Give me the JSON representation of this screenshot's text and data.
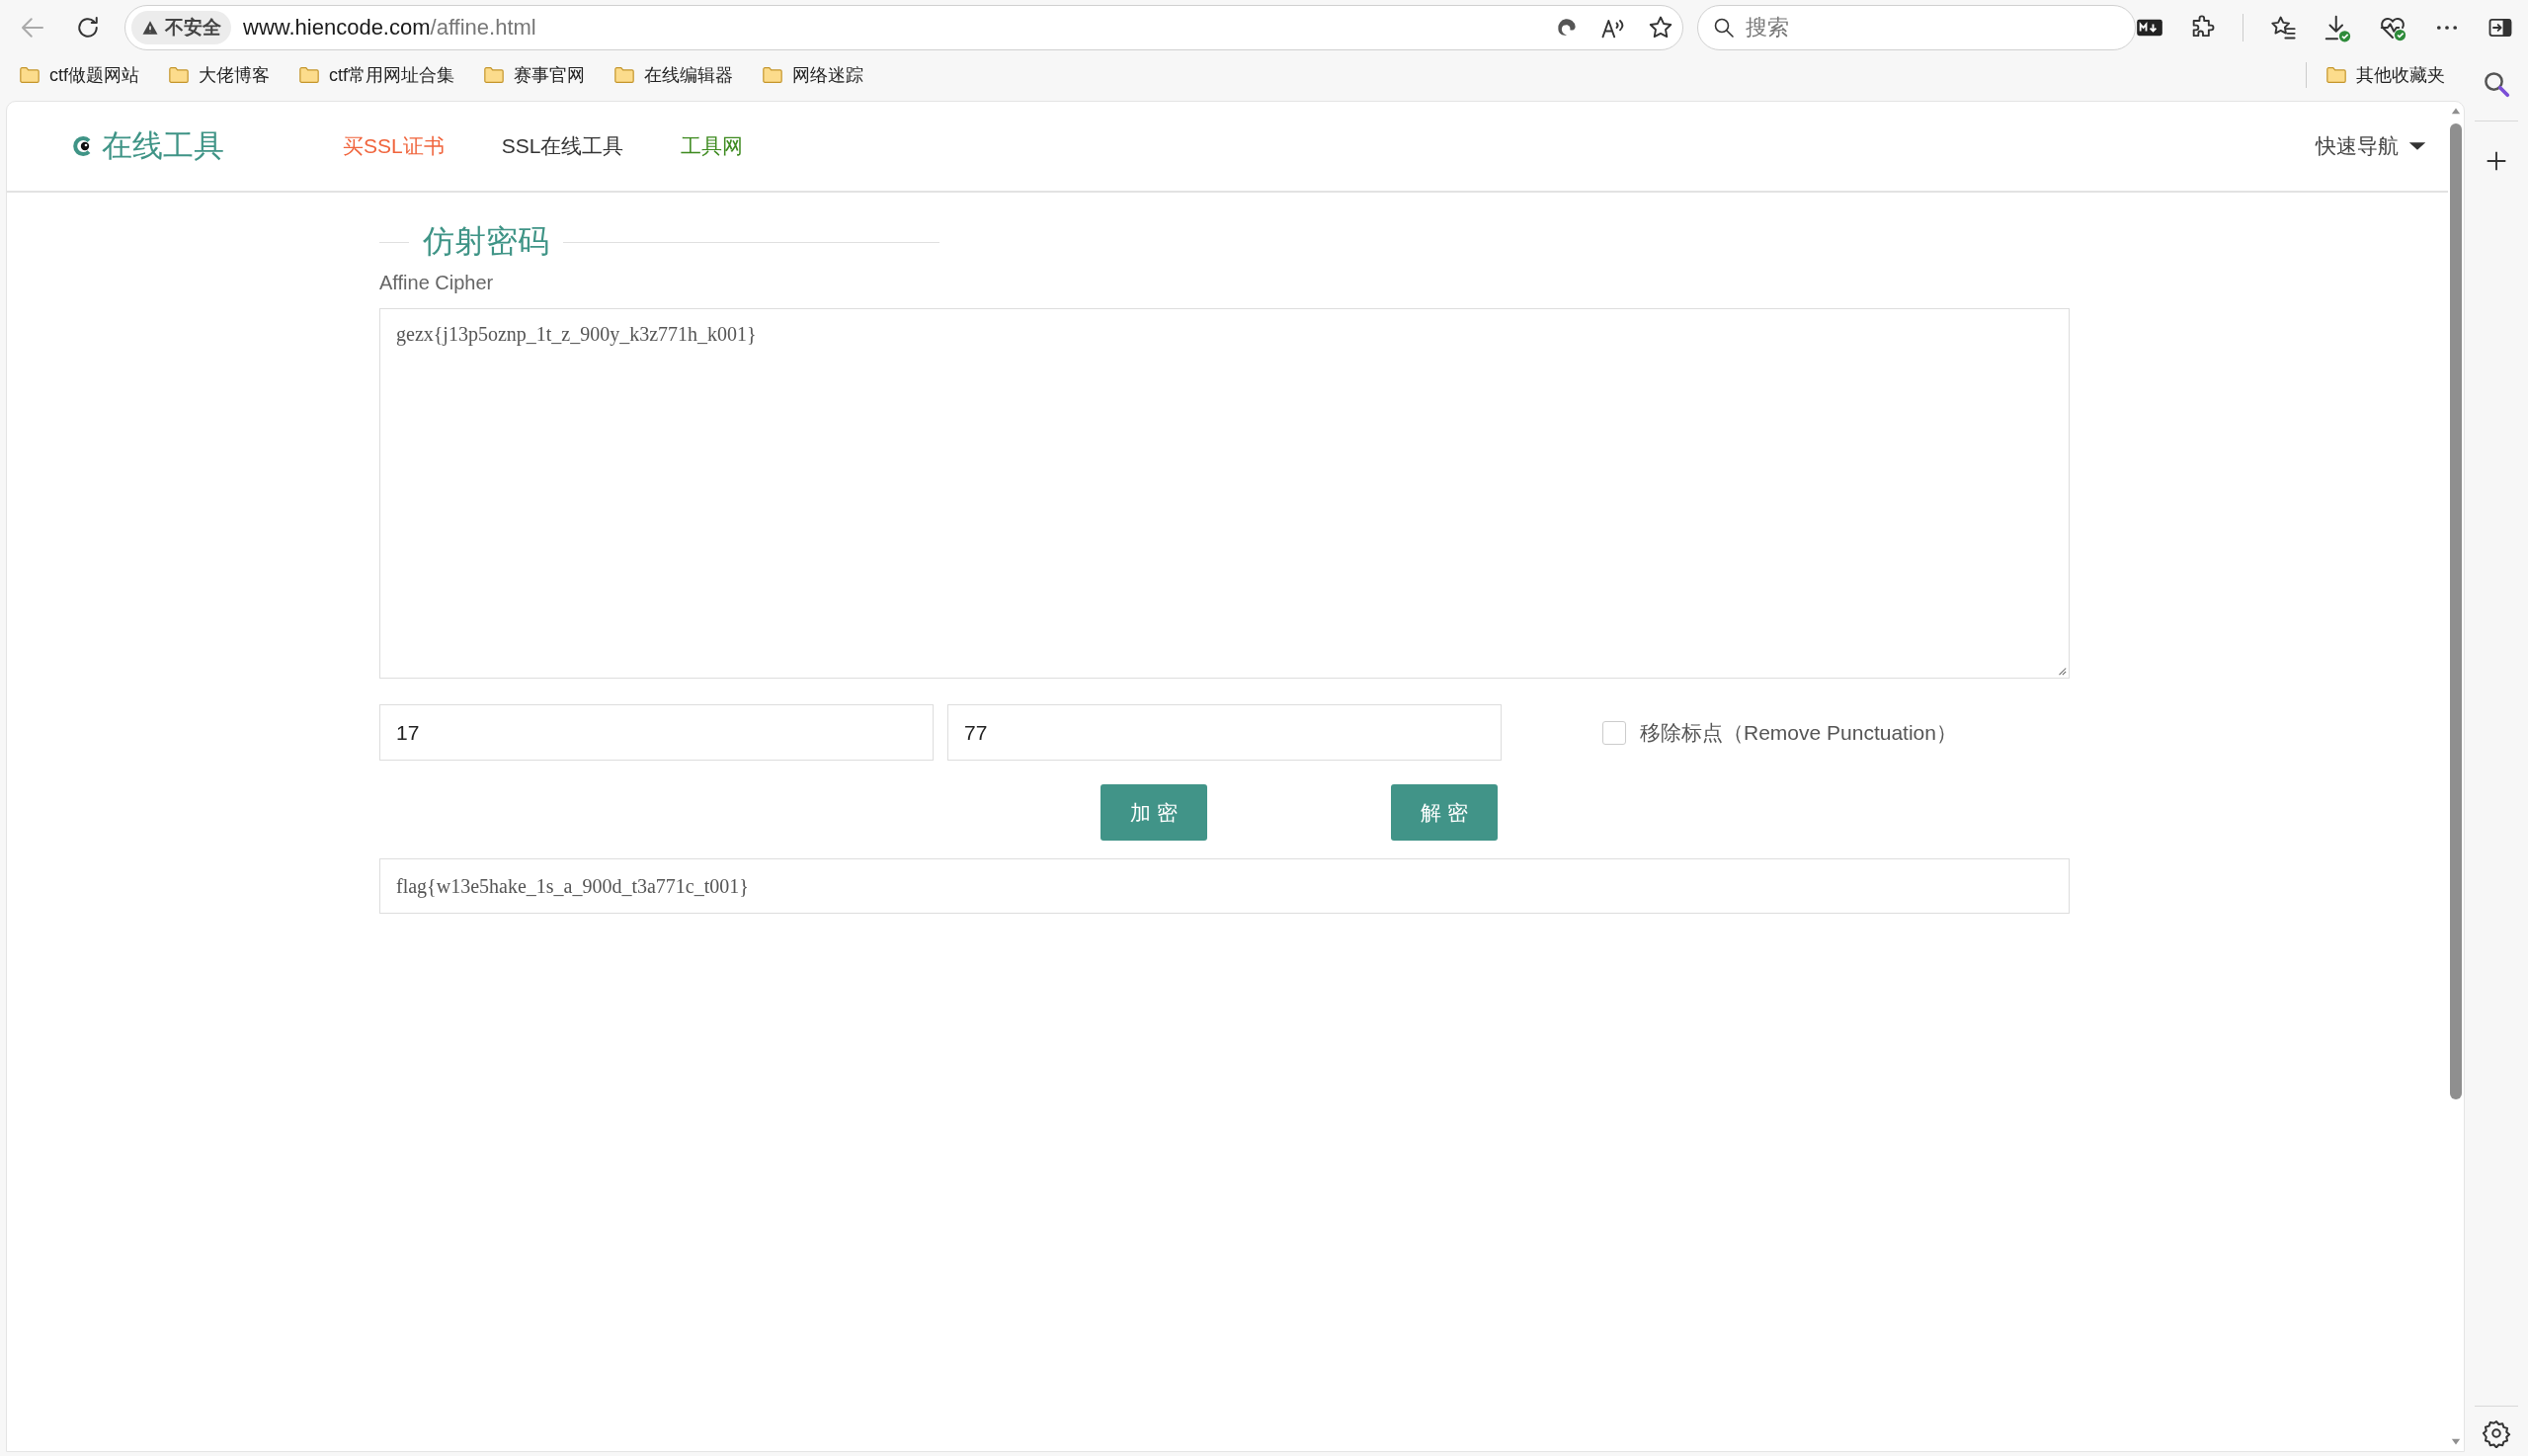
{
  "browser": {
    "security_label": "不安全",
    "url_host": "www.hiencode.com",
    "url_path": "/affine.html",
    "search": {
      "placeholder": "搜索"
    },
    "bookmarks": [
      {
        "label": "ctf做题网站"
      },
      {
        "label": "大佬博客"
      },
      {
        "label": "ctf常用网址合集"
      },
      {
        "label": "赛事官网"
      },
      {
        "label": "在线编辑器"
      },
      {
        "label": "网络迷踪"
      }
    ],
    "other_bookmarks": "其他收藏夹"
  },
  "site": {
    "logo": "在线工具",
    "nav": [
      {
        "label": "买SSL证书",
        "color": "#f0643c"
      },
      {
        "label": "SSL在线工具",
        "color": "#333333"
      },
      {
        "label": "工具网",
        "color": "#3d8a1f"
      }
    ],
    "quick_nav": "快速导航"
  },
  "tool": {
    "title": "仿射密码",
    "subtitle": "Affine Cipher",
    "input_text": "gezx{j13p5oznp_1t_z_900y_k3z771h_k001}",
    "key_a": "17",
    "key_b": "77",
    "remove_punctuation": {
      "label": "移除标点（Remove Punctuation）",
      "checked": false
    },
    "buttons": [
      "加 密",
      "解 密"
    ],
    "output": "flag{w13e5hake_1s_a_900d_t3a771c_t001}"
  }
}
